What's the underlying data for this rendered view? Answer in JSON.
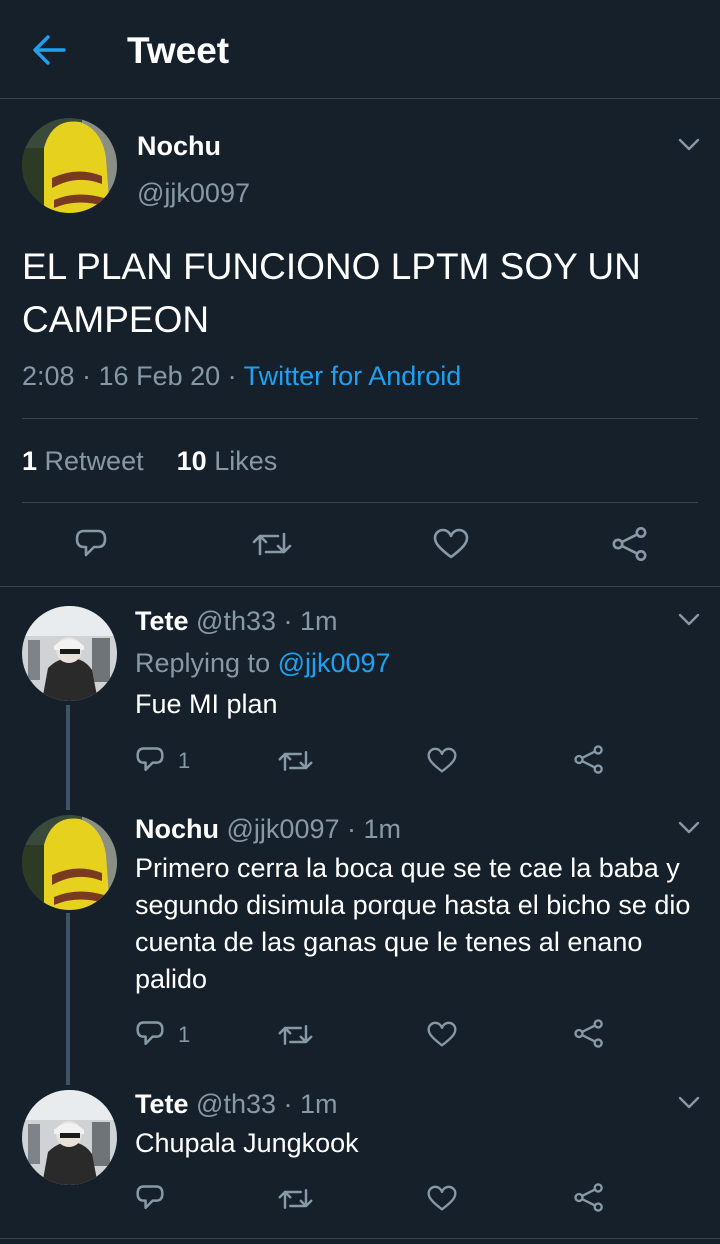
{
  "header": {
    "title": "Tweet"
  },
  "main_tweet": {
    "name": "Nochu",
    "handle": "@jjk0097",
    "text": "EL PLAN FUNCIONO LPTM SOY UN CAMPEON",
    "time": "2:08 · 16 Feb 20 · ",
    "source": "Twitter for Android",
    "retweet_count": "1",
    "retweet_label": "Retweet",
    "like_count": "10",
    "like_label": "Likes"
  },
  "replies": [
    {
      "name": "Tete",
      "handle": "@th33 · 1m",
      "replying_prefix": "Replying to ",
      "replying_to": "@jjk0097",
      "text": "Fue MI plan",
      "reply_count": "1"
    },
    {
      "name": "Nochu",
      "handle": "@jjk0097 · 1m",
      "text": "Primero cerra la boca que se te cae la baba y segundo disimula porque hasta el bicho se dio cuenta de las ganas que le tenes al enano palido",
      "reply_count": "1"
    },
    {
      "name": "Tete",
      "handle": "@th33 · 1m",
      "text": "Chupala Jungkook"
    }
  ],
  "colors": {
    "background": "#15202b",
    "accent": "#1da1f2",
    "muted": "#8899a6",
    "divider": "#38444d"
  },
  "icons": [
    "back-arrow-icon",
    "chevron-down-icon",
    "reply-icon",
    "retweet-icon",
    "like-icon",
    "share-icon"
  ]
}
